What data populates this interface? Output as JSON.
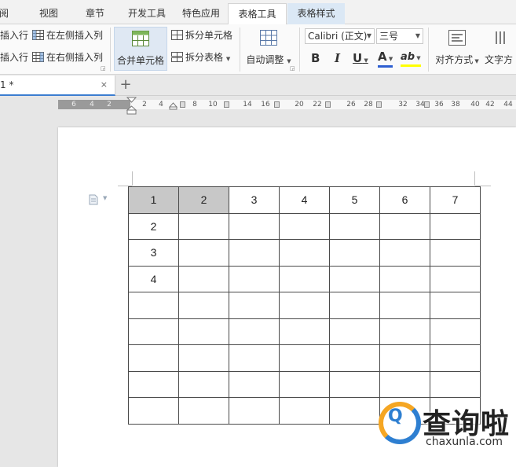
{
  "tabs": [
    {
      "label": "阅",
      "state": "normal"
    },
    {
      "label": "视图",
      "state": "normal"
    },
    {
      "label": "章节",
      "state": "normal"
    },
    {
      "label": "开发工具",
      "state": "normal"
    },
    {
      "label": "特色应用",
      "state": "normal"
    },
    {
      "label": "表格工具",
      "state": "active"
    },
    {
      "label": "表格样式",
      "state": "contextual"
    }
  ],
  "ribbon": {
    "insert_row_above": "插入行",
    "insert_row_below": "插入行",
    "insert_col_left": "在左侧插入列",
    "insert_col_right": "在右侧插入列",
    "merge_cells": "合并单元格",
    "split_cells": "拆分单元格",
    "split_table": "拆分表格",
    "auto_fit": "自动调整",
    "font_name": "Calibri (正文)",
    "font_size": "三号",
    "bold": "B",
    "italic": "I",
    "underline": "U",
    "font_color": "A",
    "highlight": "ab",
    "align": "对齐方式",
    "text_dir": "文字方"
  },
  "document": {
    "tab_title": "1 *",
    "close": "×",
    "new_tab": "+"
  },
  "ruler": {
    "left_numbers": [
      "6",
      "4",
      "2"
    ],
    "right_numbers": [
      "2",
      "4",
      "8",
      "10",
      "14",
      "16",
      "20",
      "22",
      "26",
      "28",
      "32",
      "34",
      "36",
      "38",
      "40",
      "42",
      "44"
    ]
  },
  "table": {
    "rows": [
      [
        "1",
        "2",
        "3",
        "4",
        "5",
        "6",
        "7"
      ],
      [
        "2",
        "",
        "",
        "",
        "",
        "",
        ""
      ],
      [
        "3",
        "",
        "",
        "",
        "",
        "",
        ""
      ],
      [
        "4",
        "",
        "",
        "",
        "",
        "",
        ""
      ],
      [
        "",
        "",
        "",
        "",
        "",
        "",
        ""
      ],
      [
        "",
        "",
        "",
        "",
        "",
        "",
        ""
      ],
      [
        "",
        "",
        "",
        "",
        "",
        "",
        ""
      ],
      [
        "",
        "",
        "",
        "",
        "",
        "",
        ""
      ],
      [
        "",
        "",
        "",
        "",
        "",
        "",
        ""
      ]
    ],
    "highlighted": [
      [
        0,
        0
      ],
      [
        0,
        1
      ]
    ]
  },
  "watermark": {
    "logo": "Q",
    "title": "查询啦",
    "url": "chaxunla.com"
  },
  "colors": {
    "accent": "#3c7dd0",
    "font_color_bar": "#2e5fd1",
    "highlight_bar": "#ffff00",
    "selected_cell": "#c8c8c8",
    "watermark_orange": "#f5a623",
    "watermark_blue": "#2e7fd1"
  },
  "icons": [
    "grid-icon",
    "merge-cells-icon",
    "split-cells-icon",
    "split-table-icon",
    "auto-fit-icon",
    "align-icon",
    "paragraph-icon"
  ]
}
